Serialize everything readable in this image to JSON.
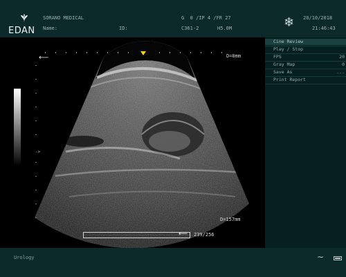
{
  "header": {
    "brand": "EDAN",
    "institution": "SORANO MEDICAL",
    "name_label": "Name:",
    "id_label": "ID:",
    "acq_params": "G  0 /IP 4 /FR 27",
    "probe": "C361-2",
    "preset_freq": "H5.0M",
    "date": "20/10/2018",
    "time": "21:46:43",
    "freeze_icon": "snowflake-icon"
  },
  "image": {
    "top_depth": "D=0mm",
    "bottom_depth": "D=157mm",
    "frame_counter": "239/256",
    "focus_marker": "->"
  },
  "menu": {
    "items": [
      {
        "label": "Cine Review",
        "value": ""
      },
      {
        "label": "Play / Stop",
        "value": ""
      },
      {
        "label": "FPS",
        "value": "20"
      },
      {
        "label": "Gray Map",
        "value": "0"
      },
      {
        "label": "Save As",
        "value": "..."
      },
      {
        "label": "Print Report",
        "value": ""
      }
    ]
  },
  "footer": {
    "exam_preset": "Urology"
  },
  "colors": {
    "panel_bg": "#0d2a2b",
    "menu_bg": "#062021",
    "menu_selected": "#1c3f40",
    "text": "#9fb2b2",
    "depth_marker": "#f0d020"
  }
}
